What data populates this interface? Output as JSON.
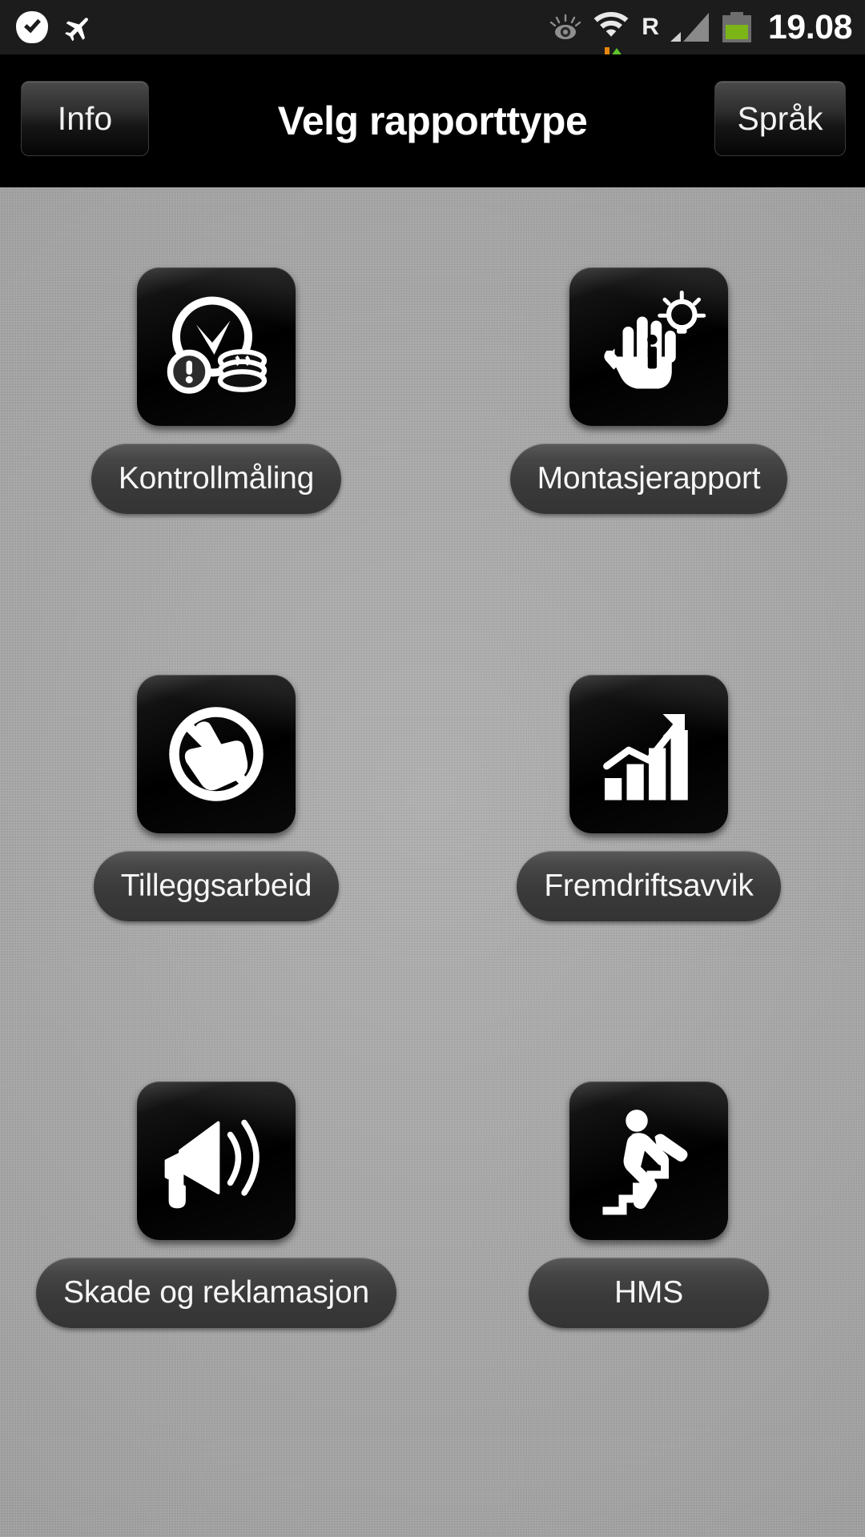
{
  "statusbar": {
    "time": "19.08",
    "icons_left": [
      "check-badge-icon",
      "airplane-mode-icon"
    ],
    "icons_right": [
      "smart-stay-eye-icon",
      "wifi-icon",
      "data-transfer-arrows-icon",
      "roaming-icon",
      "signal-bars-icon",
      "battery-icon"
    ],
    "roaming_label": "R",
    "battery_color": "#7cb518"
  },
  "header": {
    "title": "Velg rapporttype",
    "info_label": "Info",
    "language_label": "Språk"
  },
  "grid": {
    "items": [
      {
        "label": "Kontrollmåling",
        "icon": "clock-alert-coins-icon"
      },
      {
        "label": "Montasjerapport",
        "icon": "hand-info-lightbulb-icon"
      },
      {
        "label": "Tilleggsarbeid",
        "icon": "no-hand-prohibition-icon"
      },
      {
        "label": "Fremdriftsavvik",
        "icon": "bar-chart-growth-icon"
      },
      {
        "label": "Skade og reklamasjon",
        "icon": "megaphone-icon"
      },
      {
        "label": "HMS",
        "icon": "person-falling-stairs-icon"
      }
    ]
  }
}
